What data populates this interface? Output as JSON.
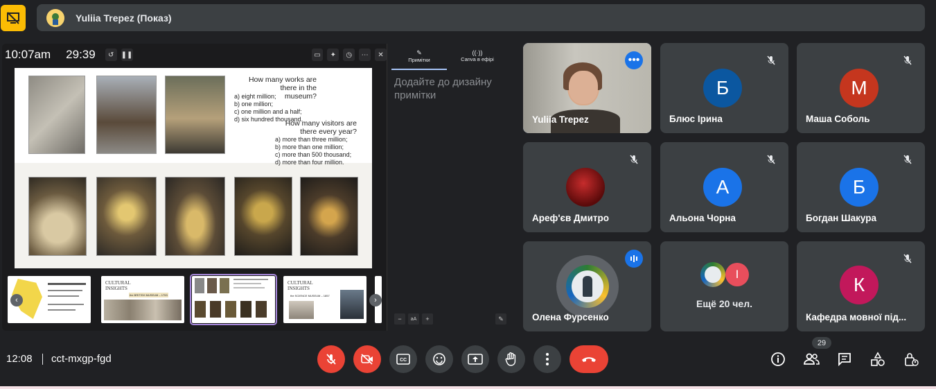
{
  "presenter": {
    "name": "Yuliia Trepez (Показ)"
  },
  "slides_panel": {
    "current_time": "10:07am",
    "timer": "29:39",
    "slide": {
      "questions_1": [
        "How many works are",
        "there in the museum?"
      ],
      "options_1": [
        "a) eight million;",
        "b) one million;",
        "c) one million and a half;",
        "d) six hundred thousand."
      ],
      "questions_2": [
        "How many visitors are",
        "there every year?"
      ],
      "options_2": [
        "a) more than three million;",
        "b) more than one million;",
        "c) more than 500 thousand;",
        "d) more than four million."
      ]
    },
    "thumbnails": [
      {
        "title": "",
        "subtitle": ""
      },
      {
        "title": "CULTURAL INSIGHTS",
        "subtitle": "the BRITISH MUSEUM – 1753"
      },
      {
        "title": "",
        "subtitle": ""
      },
      {
        "title": "CULTURAL INSIGHTS",
        "subtitle": "the SCIENCE MUSEUM – 1857"
      }
    ],
    "notes_tabs": [
      "Примітки",
      "Canva в ефірі"
    ],
    "notes_placeholder": "Додайте до дизайну примітки",
    "font_btn": "aA"
  },
  "participants": [
    {
      "name": "Yuliia Trepez",
      "initial": "",
      "color": "",
      "muted": false
    },
    {
      "name": "Блюс Ірина",
      "initial": "Б",
      "color": "#0b57a0",
      "muted": true
    },
    {
      "name": "Маша Соболь",
      "initial": "М",
      "color": "#c5361e",
      "muted": true
    },
    {
      "name": "Ареф'єв Дмитро",
      "initial": "",
      "color": "#8e1a1a",
      "muted": true
    },
    {
      "name": "Альона Чорна",
      "initial": "А",
      "color": "#1a73e8",
      "muted": true
    },
    {
      "name": "Богдан Шакура",
      "initial": "Б",
      "color": "#1a73e8",
      "muted": true
    },
    {
      "name": "Олена Фурсенко",
      "initial": "",
      "color": "#5f6368",
      "muted": false
    },
    {
      "name": "Ещё 20 чел.",
      "initial": "I",
      "color": "#e84e5c",
      "muted": false
    },
    {
      "name": "Кафедра мовної під...",
      "initial": "К",
      "color": "#c2185b",
      "muted": true
    }
  ],
  "meeting": {
    "clock": "12:08",
    "code": "cct-mxgp-fgd",
    "participant_count": "29"
  },
  "colors": {
    "accent": "#8ab4f8",
    "danger": "#ea4335",
    "tile": "#3c4043",
    "bg": "#202124"
  }
}
